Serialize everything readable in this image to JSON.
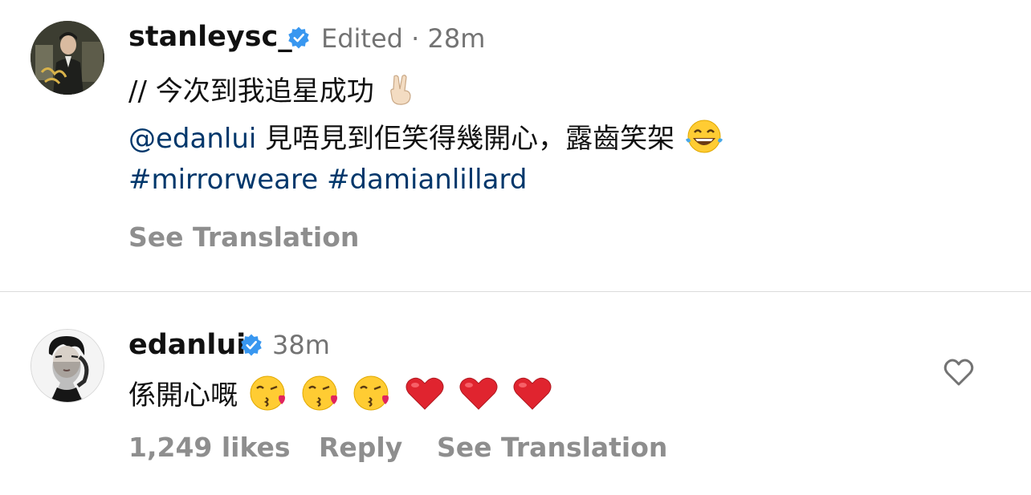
{
  "post": {
    "username": "stanleysc_",
    "verified": true,
    "meta": "Edited · 28m",
    "line1_text": "// 今次到我追星成功",
    "line1_emoji": "victory-hand-emoji",
    "line2_mention": "@edanlui",
    "line2_text": " 見唔見到佢笑得幾開心，露齒笑架",
    "line2_emoji": "tears-of-joy-emoji",
    "hashtag1": "#mirrorweare",
    "hashtag2": "#damianlillard",
    "see_translation": "See Translation"
  },
  "comment": {
    "username": "edanlui",
    "verified": true,
    "time": "38m",
    "text": "係開心嘅",
    "emojis": [
      "kiss-emoji",
      "kiss-emoji",
      "kiss-emoji",
      "red-heart-emoji",
      "red-heart-emoji",
      "red-heart-emoji"
    ],
    "likes": "1,249 likes",
    "reply": "Reply",
    "see_translation": "See Translation"
  },
  "colors": {
    "link": "#00376b",
    "verified_badge": "#3897f0",
    "secondary_text": "#737373",
    "action_text": "#8e8e8e",
    "divider": "#dbdbdb"
  }
}
